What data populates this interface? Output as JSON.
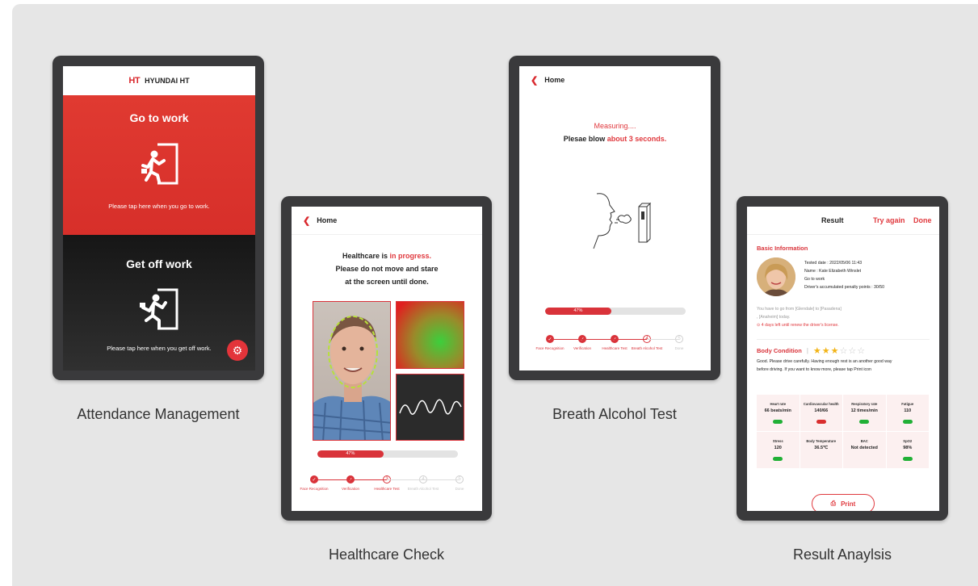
{
  "captions": {
    "attendance": "Attendance Management",
    "healthcare": "Healthcare Check",
    "alcohol": "Breath Alcohol Test",
    "result": "Result Anaylsis"
  },
  "attendance": {
    "logo_mark": "HT",
    "brand": "HYUNDAI HT",
    "go_title": "Go to work",
    "go_note": "Please tap here when you go to work.",
    "off_title": "Get off work",
    "off_note": "Please tap here when you get off work.",
    "settings_icon": "gear-icon"
  },
  "healthcare": {
    "nav_back": "Home",
    "msg_prefix": "Healthcare is ",
    "msg_highlight": "in progress.",
    "msg_line2": "Please do not move and stare",
    "msg_line3": "at the screen until done.",
    "progress_label": "47%",
    "progress_value": 0.47,
    "steps": [
      {
        "label": "Face Recognition",
        "state": "done",
        "mark": "✓"
      },
      {
        "label": "Verification",
        "state": "done",
        "mark": "✓"
      },
      {
        "label": "Healthcare Test",
        "state": "current",
        "mark": "3"
      },
      {
        "label": "Breath Alcohol Test",
        "state": "todo",
        "mark": "4"
      },
      {
        "label": "Done",
        "state": "todo",
        "mark": "5"
      }
    ]
  },
  "alcohol": {
    "nav_back": "Home",
    "measuring": "Measuring....",
    "blow_prefix": "Plesae blow ",
    "blow_highlight": "about 3 seconds.",
    "progress_label": "47%",
    "progress_value": 0.47,
    "steps": [
      {
        "label": "Face Recognition",
        "state": "done",
        "mark": "✓"
      },
      {
        "label": "Verification",
        "state": "done",
        "mark": "✓"
      },
      {
        "label": "Healthcare Test",
        "state": "done",
        "mark": "✓"
      },
      {
        "label": "Breath Alcohol Test",
        "state": "current",
        "mark": "4"
      },
      {
        "label": "Done",
        "state": "todo",
        "mark": "5"
      }
    ]
  },
  "result": {
    "title": "Result",
    "try_again": "Try again",
    "done": "Done",
    "basic_info_title": "Basic Information",
    "tested_date": "Tested date : 2022/05/06 11:43",
    "name": "Name : Kate Elizabeth Winslet",
    "mode": "Go to work",
    "penalty": "Driver's accumulated penalty points : 30/50",
    "route_line1": "You have to go from [Glendale] to [Pasadena]",
    "route_line2": ", [Anaheim] today.",
    "license_warning": "4 days left until renew the driver's license.",
    "body_condition_title": "Body Condition",
    "rating": 3,
    "rating_max": 6,
    "advice_line1": "Good. Please drive carefully. Having enough rest is an another good way",
    "advice_line2": "before driving. If you want to know more, please tap Print icon",
    "metrics": [
      {
        "label": "Heart rate",
        "value": "66 beats/min",
        "status": "good"
      },
      {
        "label": "Cardiovascular health",
        "value": "140/66",
        "status": "caution"
      },
      {
        "label": "Respiratory rate",
        "value": "12 times/min",
        "status": "good"
      },
      {
        "label": "Fatigue",
        "value": "110",
        "status": "good"
      },
      {
        "label": "Stress",
        "value": "120",
        "status": "good"
      },
      {
        "label": "Body Temperature",
        "value": "36.5℃",
        "status": "none"
      },
      {
        "label": "BAC",
        "value": "Not detected",
        "status": "none"
      },
      {
        "label": "SpO2",
        "value": "98%",
        "status": "good"
      }
    ],
    "print_label": "Print"
  }
}
